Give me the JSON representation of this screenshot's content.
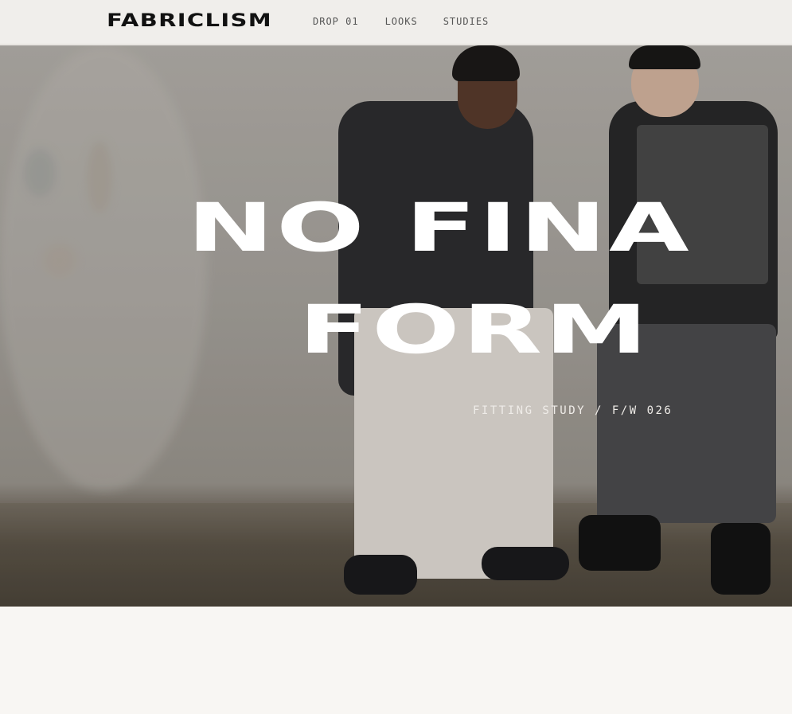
{
  "brand": {
    "logo": "FABRICLISM"
  },
  "nav": {
    "items": [
      {
        "label": "DROP 01"
      },
      {
        "label": "LOOKS"
      },
      {
        "label": "STUDIES"
      }
    ]
  },
  "hero": {
    "headline_line1": "NO FINA",
    "headline_line2": "FORM",
    "subtitle": "FITTING STUDY / F/W 026"
  },
  "colors": {
    "page_background": "#f8f6f3",
    "topbar_background": "#f0eeeb",
    "logo": "#111111",
    "nav_text": "#555555",
    "headline": "#ffffff"
  }
}
